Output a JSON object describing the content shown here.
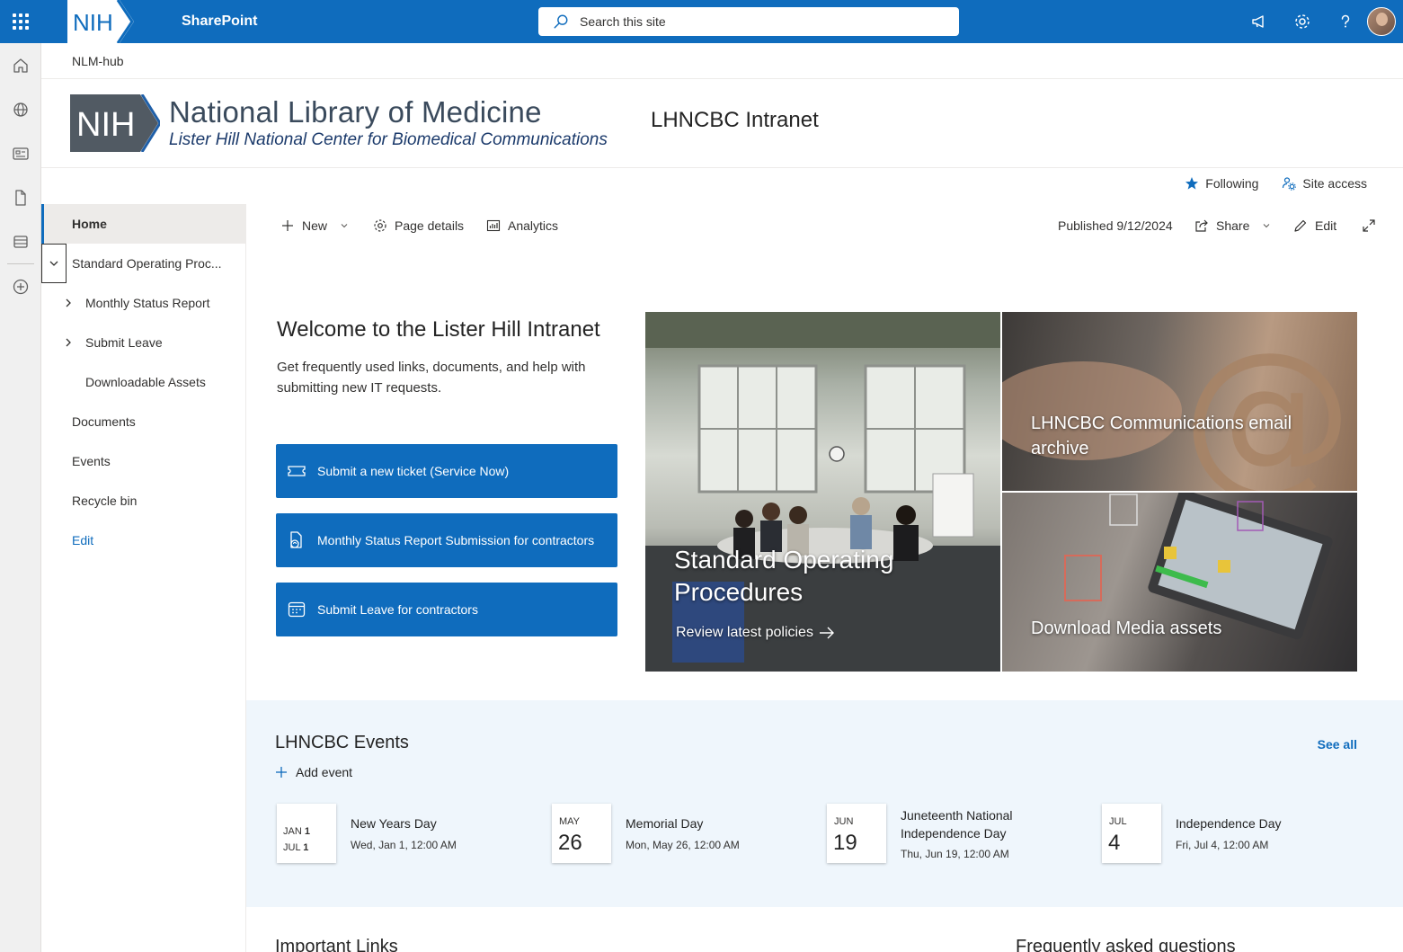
{
  "suite": {
    "app_name": "SharePoint",
    "logo_text": "NIH",
    "search_placeholder": "Search this site"
  },
  "hub": {
    "name": "NLM-hub"
  },
  "site": {
    "logo_text": "NIH",
    "org_name": "National Library of Medicine",
    "org_sub": "Lister Hill National Center for Biomedical Communications",
    "title": "LHNCBC Intranet"
  },
  "follow": {
    "following": "Following",
    "site_access": "Site access"
  },
  "leftnav": {
    "items": [
      {
        "label": "Home"
      },
      {
        "label": "Standard Operating Proc..."
      },
      {
        "label": "Monthly Status Report"
      },
      {
        "label": "Submit Leave"
      },
      {
        "label": "Downloadable Assets"
      },
      {
        "label": "Documents"
      },
      {
        "label": "Events"
      },
      {
        "label": "Recycle bin"
      },
      {
        "label": "Edit"
      }
    ]
  },
  "command": {
    "new": "New",
    "page_details": "Page details",
    "analytics": "Analytics",
    "published": "Published 9/12/2024",
    "share": "Share",
    "edit": "Edit"
  },
  "welcome": {
    "title": "Welcome to the Lister Hill Intranet",
    "desc": "Get frequently used links, documents, and help with submitting new IT requests.",
    "buttons": [
      {
        "label": "Submit a new ticket (Service Now)"
      },
      {
        "label": "Monthly Status Report Submission for contractors"
      },
      {
        "label": "Submit Leave for contractors"
      }
    ]
  },
  "hero": {
    "sop_title": "Standard Operating Procedures",
    "sop_link": "Review latest policies",
    "email_title": "LHNCBC Communications email archive",
    "media_title": "Download Media assets"
  },
  "events": {
    "title": "LHNCBC Events",
    "see_all": "See all",
    "add_event": "Add event",
    "items": [
      {
        "range_start": "JAN",
        "range_start_day": "1",
        "range_end": "JUL",
        "range_end_day": "1",
        "title": "New Years Day",
        "time": "Wed, Jan 1, 12:00 AM"
      },
      {
        "month": "MAY",
        "day": "26",
        "title": "Memorial Day",
        "time": "Mon, May 26, 12:00 AM"
      },
      {
        "month": "JUN",
        "day": "19",
        "title": "Juneteenth National Independence Day",
        "time": "Thu, Jun 19, 12:00 AM"
      },
      {
        "month": "JUL",
        "day": "4",
        "title": "Independence Day",
        "time": "Fri, Jul 4, 12:00 AM"
      }
    ]
  },
  "bottom": {
    "important_links": "Important Links",
    "faq": "Frequently asked questions"
  },
  "colors": {
    "brand": "#0f6cbd",
    "events_bg": "#eff6fc",
    "nav_selected": "#edebe9"
  }
}
